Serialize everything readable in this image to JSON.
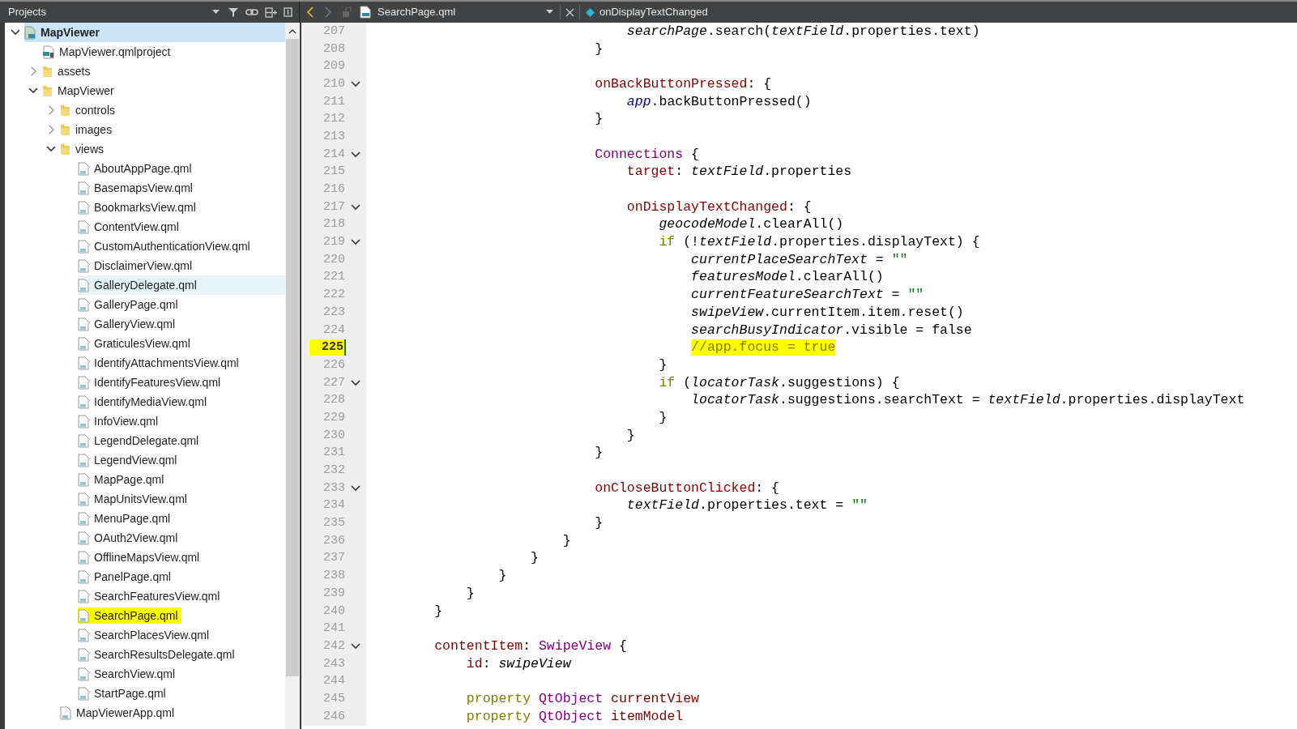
{
  "toolbar": {
    "panel_title": "Projects",
    "file_name": "SearchPage.qml",
    "symbol": "onDisplayTextChanged"
  },
  "tree": [
    {
      "kind": "project",
      "label": "MapViewer",
      "expanded": true,
      "selected": true,
      "hovered": false,
      "marked": false,
      "children": [
        {
          "kind": "projectfile",
          "label": "MapViewer.qmlproject",
          "selected": false,
          "hovered": false,
          "marked": false
        },
        {
          "kind": "folder",
          "label": "assets",
          "expanded": false,
          "selected": false,
          "hovered": false,
          "marked": false
        },
        {
          "kind": "folder",
          "label": "MapViewer",
          "expanded": true,
          "selected": false,
          "hovered": false,
          "marked": false,
          "children": [
            {
              "kind": "folder",
              "label": "controls",
              "expanded": false,
              "selected": false,
              "hovered": false,
              "marked": false
            },
            {
              "kind": "folder",
              "label": "images",
              "expanded": false,
              "selected": false,
              "hovered": false,
              "marked": false
            },
            {
              "kind": "folder",
              "label": "views",
              "expanded": true,
              "selected": false,
              "hovered": false,
              "marked": false,
              "children": [
                {
                  "kind": "qml",
                  "label": "AboutAppPage.qml",
                  "selected": false,
                  "hovered": false,
                  "marked": false
                },
                {
                  "kind": "qml",
                  "label": "BasemapsView.qml",
                  "selected": false,
                  "hovered": false,
                  "marked": false
                },
                {
                  "kind": "qml",
                  "label": "BookmarksView.qml",
                  "selected": false,
                  "hovered": false,
                  "marked": false
                },
                {
                  "kind": "qml",
                  "label": "ContentView.qml",
                  "selected": false,
                  "hovered": false,
                  "marked": false
                },
                {
                  "kind": "qml",
                  "label": "CustomAuthenticationView.qml",
                  "selected": false,
                  "hovered": false,
                  "marked": false
                },
                {
                  "kind": "qml",
                  "label": "DisclaimerView.qml",
                  "selected": false,
                  "hovered": false,
                  "marked": false
                },
                {
                  "kind": "qml",
                  "label": "GalleryDelegate.qml",
                  "selected": false,
                  "hovered": true,
                  "marked": false
                },
                {
                  "kind": "qml",
                  "label": "GalleryPage.qml",
                  "selected": false,
                  "hovered": false,
                  "marked": false
                },
                {
                  "kind": "qml",
                  "label": "GalleryView.qml",
                  "selected": false,
                  "hovered": false,
                  "marked": false
                },
                {
                  "kind": "qml",
                  "label": "GraticulesView.qml",
                  "selected": false,
                  "hovered": false,
                  "marked": false
                },
                {
                  "kind": "qml",
                  "label": "IdentifyAttachmentsView.qml",
                  "selected": false,
                  "hovered": false,
                  "marked": false
                },
                {
                  "kind": "qml",
                  "label": "IdentifyFeaturesView.qml",
                  "selected": false,
                  "hovered": false,
                  "marked": false
                },
                {
                  "kind": "qml",
                  "label": "IdentifyMediaView.qml",
                  "selected": false,
                  "hovered": false,
                  "marked": false
                },
                {
                  "kind": "qml",
                  "label": "InfoView.qml",
                  "selected": false,
                  "hovered": false,
                  "marked": false
                },
                {
                  "kind": "qml",
                  "label": "LegendDelegate.qml",
                  "selected": false,
                  "hovered": false,
                  "marked": false
                },
                {
                  "kind": "qml",
                  "label": "LegendView.qml",
                  "selected": false,
                  "hovered": false,
                  "marked": false
                },
                {
                  "kind": "qml",
                  "label": "MapPage.qml",
                  "selected": false,
                  "hovered": false,
                  "marked": false
                },
                {
                  "kind": "qml",
                  "label": "MapUnitsView.qml",
                  "selected": false,
                  "hovered": false,
                  "marked": false
                },
                {
                  "kind": "qml",
                  "label": "MenuPage.qml",
                  "selected": false,
                  "hovered": false,
                  "marked": false
                },
                {
                  "kind": "qml",
                  "label": "OAuth2View.qml",
                  "selected": false,
                  "hovered": false,
                  "marked": false
                },
                {
                  "kind": "qml",
                  "label": "OfflineMapsView.qml",
                  "selected": false,
                  "hovered": false,
                  "marked": false
                },
                {
                  "kind": "qml",
                  "label": "PanelPage.qml",
                  "selected": false,
                  "hovered": false,
                  "marked": false
                },
                {
                  "kind": "qml",
                  "label": "SearchFeaturesView.qml",
                  "selected": false,
                  "hovered": false,
                  "marked": false
                },
                {
                  "kind": "qml",
                  "label": "SearchPage.qml",
                  "selected": false,
                  "hovered": false,
                  "marked": true
                },
                {
                  "kind": "qml",
                  "label": "SearchPlacesView.qml",
                  "selected": false,
                  "hovered": false,
                  "marked": false
                },
                {
                  "kind": "qml",
                  "label": "SearchResultsDelegate.qml",
                  "selected": false,
                  "hovered": false,
                  "marked": false
                },
                {
                  "kind": "qml",
                  "label": "SearchView.qml",
                  "selected": false,
                  "hovered": false,
                  "marked": false
                },
                {
                  "kind": "qml",
                  "label": "StartPage.qml",
                  "selected": false,
                  "hovered": false,
                  "marked": false
                }
              ]
            },
            {
              "kind": "qml",
              "label": "MapViewerApp.qml",
              "selected": false,
              "hovered": false,
              "marked": false
            }
          ]
        }
      ]
    }
  ],
  "code": [
    {
      "number": "207",
      "fold": false,
      "marked": false,
      "segments": [
        {
          "kind": "id",
          "text": "                                searchPage"
        },
        {
          "kind": "plain",
          "text": ".search("
        },
        {
          "kind": "id",
          "text": "textField"
        },
        {
          "kind": "plain",
          "text": ".properties.text)"
        }
      ]
    },
    {
      "number": "208",
      "fold": false,
      "marked": false,
      "segments": [
        {
          "kind": "plain",
          "text": "                            }"
        }
      ]
    },
    {
      "number": "209",
      "fold": false,
      "marked": false
    },
    {
      "number": "210",
      "fold": true,
      "marked": false,
      "segments": [
        {
          "kind": "prop",
          "text": "                            onBackButtonPressed"
        },
        {
          "kind": "plain",
          "text": ": {"
        }
      ]
    },
    {
      "number": "211",
      "fold": false,
      "marked": false,
      "segments": [
        {
          "kind": "builtin",
          "text": "                                app"
        },
        {
          "kind": "plain",
          "text": ".backButtonPressed()"
        }
      ]
    },
    {
      "number": "212",
      "fold": false,
      "marked": false,
      "segments": [
        {
          "kind": "plain",
          "text": "                            }"
        }
      ]
    },
    {
      "number": "213",
      "fold": false,
      "marked": false
    },
    {
      "number": "214",
      "fold": true,
      "marked": false,
      "segments": [
        {
          "kind": "type",
          "text": "                            Connections"
        },
        {
          "kind": "plain",
          "text": " {"
        }
      ]
    },
    {
      "number": "215",
      "fold": false,
      "marked": false,
      "segments": [
        {
          "kind": "prop",
          "text": "                                target"
        },
        {
          "kind": "plain",
          "text": ": "
        },
        {
          "kind": "id",
          "text": "textField"
        },
        {
          "kind": "plain",
          "text": ".properties"
        }
      ]
    },
    {
      "number": "216",
      "fold": false,
      "marked": false
    },
    {
      "number": "217",
      "fold": true,
      "marked": false,
      "segments": [
        {
          "kind": "prop",
          "text": "                                onDisplayTextChanged"
        },
        {
          "kind": "plain",
          "text": ": {"
        }
      ]
    },
    {
      "number": "218",
      "fold": false,
      "marked": false,
      "segments": [
        {
          "kind": "id",
          "text": "                                    geocodeModel"
        },
        {
          "kind": "plain",
          "text": ".clearAll()"
        }
      ]
    },
    {
      "number": "219",
      "fold": true,
      "marked": false,
      "segments": [
        {
          "kind": "keyword",
          "text": "                                    if"
        },
        {
          "kind": "plain",
          "text": " (!"
        },
        {
          "kind": "id",
          "text": "textField"
        },
        {
          "kind": "plain",
          "text": ".properties.displayText) {"
        }
      ]
    },
    {
      "number": "220",
      "fold": false,
      "marked": false,
      "segments": [
        {
          "kind": "id",
          "text": "                                        currentPlaceSearchText"
        },
        {
          "kind": "plain",
          "text": " = "
        },
        {
          "kind": "string",
          "text": "\"\""
        }
      ]
    },
    {
      "number": "221",
      "fold": false,
      "marked": false,
      "segments": [
        {
          "kind": "id",
          "text": "                                        featuresModel"
        },
        {
          "kind": "plain",
          "text": ".clearAll()"
        }
      ]
    },
    {
      "number": "222",
      "fold": false,
      "marked": false,
      "segments": [
        {
          "kind": "id",
          "text": "                                        currentFeatureSearchText"
        },
        {
          "kind": "plain",
          "text": " = "
        },
        {
          "kind": "string",
          "text": "\"\""
        }
      ]
    },
    {
      "number": "223",
      "fold": false,
      "marked": false,
      "segments": [
        {
          "kind": "id",
          "text": "                                        swipeView"
        },
        {
          "kind": "plain",
          "text": ".currentItem.item.reset()"
        }
      ]
    },
    {
      "number": "224",
      "fold": false,
      "marked": false,
      "segments": [
        {
          "kind": "id",
          "text": "                                        searchBusyIndicator"
        },
        {
          "kind": "plain",
          "text": ".visible = false"
        }
      ]
    },
    {
      "number": "225",
      "fold": false,
      "marked": true,
      "segments": [
        {
          "kind": "comment",
          "text": "                                        //app.focus = true"
        }
      ]
    },
    {
      "number": "226",
      "fold": false,
      "marked": false,
      "segments": [
        {
          "kind": "plain",
          "text": "                                    }"
        }
      ]
    },
    {
      "number": "227",
      "fold": true,
      "marked": false,
      "segments": [
        {
          "kind": "keyword",
          "text": "                                    if"
        },
        {
          "kind": "plain",
          "text": " ("
        },
        {
          "kind": "id",
          "text": "locatorTask"
        },
        {
          "kind": "plain",
          "text": ".suggestions) {"
        }
      ]
    },
    {
      "number": "228",
      "fold": false,
      "marked": false,
      "segments": [
        {
          "kind": "id",
          "text": "                                        locatorTask"
        },
        {
          "kind": "plain",
          "text": ".suggestions.searchText = "
        },
        {
          "kind": "id",
          "text": "textField"
        },
        {
          "kind": "plain",
          "text": ".properties.displayText"
        }
      ]
    },
    {
      "number": "229",
      "fold": false,
      "marked": false,
      "segments": [
        {
          "kind": "plain",
          "text": "                                    }"
        }
      ]
    },
    {
      "number": "230",
      "fold": false,
      "marked": false,
      "segments": [
        {
          "kind": "plain",
          "text": "                                }"
        }
      ]
    },
    {
      "number": "231",
      "fold": false,
      "marked": false,
      "segments": [
        {
          "kind": "plain",
          "text": "                            }"
        }
      ]
    },
    {
      "number": "232",
      "fold": false,
      "marked": false
    },
    {
      "number": "233",
      "fold": true,
      "marked": false,
      "segments": [
        {
          "kind": "prop",
          "text": "                            onCloseButtonClicked"
        },
        {
          "kind": "plain",
          "text": ": {"
        }
      ]
    },
    {
      "number": "234",
      "fold": false,
      "marked": false,
      "segments": [
        {
          "kind": "id",
          "text": "                                textField"
        },
        {
          "kind": "plain",
          "text": ".properties.text = "
        },
        {
          "kind": "string",
          "text": "\"\""
        }
      ]
    },
    {
      "number": "235",
      "fold": false,
      "marked": false,
      "segments": [
        {
          "kind": "plain",
          "text": "                            }"
        }
      ]
    },
    {
      "number": "236",
      "fold": false,
      "marked": false,
      "segments": [
        {
          "kind": "plain",
          "text": "                        }"
        }
      ]
    },
    {
      "number": "237",
      "fold": false,
      "marked": false,
      "segments": [
        {
          "kind": "plain",
          "text": "                    }"
        }
      ]
    },
    {
      "number": "238",
      "fold": false,
      "marked": false,
      "segments": [
        {
          "kind": "plain",
          "text": "                }"
        }
      ]
    },
    {
      "number": "239",
      "fold": false,
      "marked": false,
      "segments": [
        {
          "kind": "plain",
          "text": "            }"
        }
      ]
    },
    {
      "number": "240",
      "fold": false,
      "marked": false,
      "segments": [
        {
          "kind": "plain",
          "text": "        }"
        }
      ]
    },
    {
      "number": "241",
      "fold": false,
      "marked": false
    },
    {
      "number": "242",
      "fold": true,
      "marked": false,
      "segments": [
        {
          "kind": "prop",
          "text": "        contentItem"
        },
        {
          "kind": "plain",
          "text": ": "
        },
        {
          "kind": "type",
          "text": "SwipeView"
        },
        {
          "kind": "plain",
          "text": " {"
        }
      ]
    },
    {
      "number": "243",
      "fold": false,
      "marked": false,
      "segments": [
        {
          "kind": "prop",
          "text": "            id"
        },
        {
          "kind": "plain",
          "text": ": "
        },
        {
          "kind": "id",
          "text": "swipeView"
        }
      ]
    },
    {
      "number": "244",
      "fold": false,
      "marked": false
    },
    {
      "number": "245",
      "fold": false,
      "marked": false,
      "segments": [
        {
          "kind": "keyword",
          "text": "            property"
        },
        {
          "kind": "type",
          "text": " QtObject"
        },
        {
          "kind": "prop",
          "text": " currentView"
        }
      ]
    },
    {
      "number": "246",
      "fold": false,
      "marked": false,
      "segments": [
        {
          "kind": "keyword",
          "text": "            property"
        },
        {
          "kind": "type",
          "text": " QtObject"
        },
        {
          "kind": "prop",
          "text": " itemModel"
        }
      ]
    }
  ]
}
